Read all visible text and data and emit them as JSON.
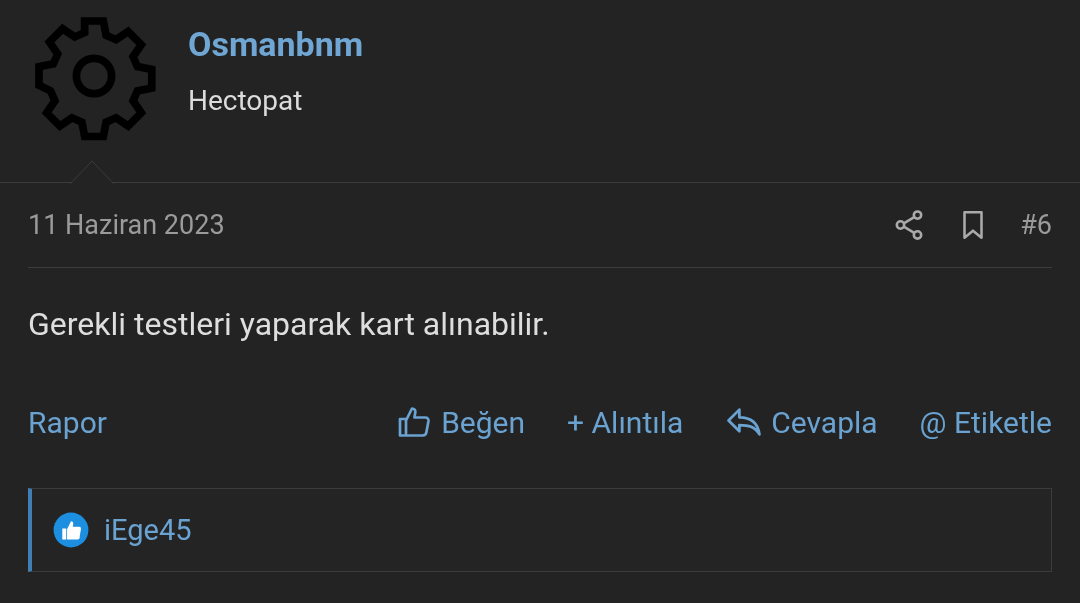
{
  "author": {
    "name": "Osmanbnm",
    "title": "Hectopat"
  },
  "post": {
    "date": "11 Haziran 2023",
    "number": "#6",
    "message": "Gerekli testleri yaparak kart alınabilir."
  },
  "actions": [
    {
      "kind": "report",
      "label": "Rapor"
    },
    {
      "kind": "like",
      "label": "Beğen"
    },
    {
      "kind": "quote",
      "label": "+ Alıntıla"
    },
    {
      "kind": "reply",
      "label": "Cevapla"
    },
    {
      "kind": "mention",
      "label": "@ Etiketle"
    }
  ],
  "reactions": {
    "users": [
      "iEge45"
    ]
  }
}
